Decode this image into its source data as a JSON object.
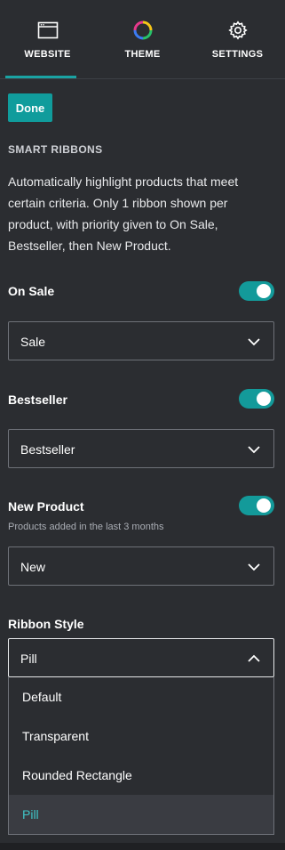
{
  "tabs": [
    {
      "label": "WEBSITE",
      "icon": "browser-window-icon",
      "active": true
    },
    {
      "label": "THEME",
      "icon": "color-wheel-icon",
      "active": false
    },
    {
      "label": "SETTINGS",
      "icon": "gear-icon",
      "active": false
    }
  ],
  "done_label": "Done",
  "section": {
    "title": "SMART RIBBONS",
    "description": "Automatically highlight products that meet certain criteria. Only 1 ribbon shown per product, with priority given to On Sale, Bestseller, then New Product."
  },
  "ribbons": {
    "on_sale": {
      "label": "On Sale",
      "enabled": true,
      "value": "Sale"
    },
    "bestseller": {
      "label": "Bestseller",
      "enabled": true,
      "value": "Bestseller"
    },
    "new_product": {
      "label": "New Product",
      "sublabel": "Products added in the last 3 months",
      "enabled": true,
      "value": "New"
    }
  },
  "ribbon_style": {
    "label": "Ribbon Style",
    "value": "Pill",
    "options": [
      "Default",
      "Transparent",
      "Rounded Rectangle",
      "Pill"
    ],
    "selected_index": 3
  },
  "colors": {
    "background": "#2b2d31",
    "accent": "#139a9a",
    "selected_text": "#3fc5c7"
  }
}
